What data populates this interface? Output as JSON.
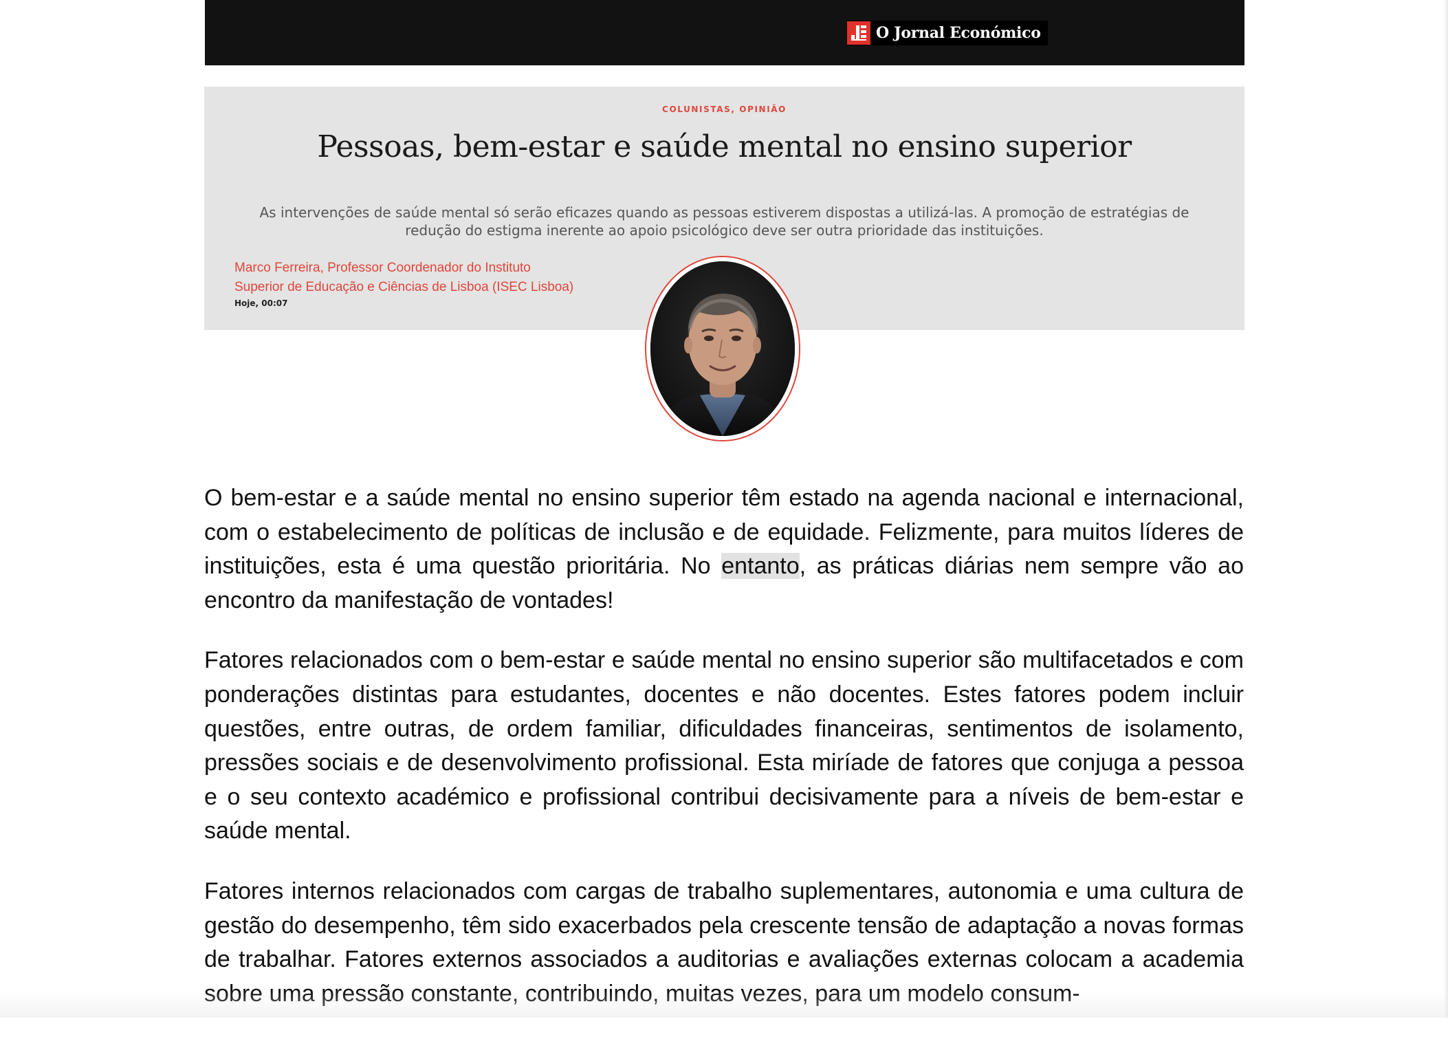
{
  "masthead": {
    "brand_name": "O Jornal Económico",
    "logo_icon": "je-logo-icon"
  },
  "hero": {
    "category": "COLUNISTAS, OPINIÃO",
    "title": "Pessoas, bem-estar e saúde mental no ensino superior",
    "lead_line1": "As intervenções de saúde mental só serão eficazes quando as pessoas estiverem dispostas a utilizá-las. A promoção de estratégias de",
    "lead_line2": "redução do estigma inerente ao apoio psicológico deve ser outra prioridade das instituições.",
    "author_line1": "Marco Ferreira, Professor Coordenador do Instituto",
    "author_line2": "Superior de Educação e Ciências de Lisboa (ISEC Lisboa)",
    "date": "Hoje, 00:07",
    "accent_color": "#e0463b"
  },
  "article": {
    "p1_before": "O bem-estar e a saúde mental no ensino superior têm estado na agenda nacional e internacional, com o estabelecimento de políticas de inclusão e de equidade. Felizmente, para muitos líderes de instituições, esta é uma questão prioritária. No ",
    "p1_highlight": "entanto",
    "p1_after": ", as práticas diárias nem sempre vão ao encontro da manifestação de vontades!",
    "p2": "Fatores relacionados com o bem-estar e saúde mental no ensino superior são multifacetados e com ponderações distintas para estudantes, docentes e não docentes. Estes fatores podem incluir questões, entre outras, de ordem familiar, dificuldades financeiras, sentimentos de isola­mento, pressões sociais e de desenvolvimento profissional. Esta miríade de fatores que conjuga a pessoa e o seu contexto académico e profissional contribui decisivamente para a níveis de bem-estar e saúde mental.",
    "p3": "Fatores internos relacionados com cargas de trabalho suplementares, autonomia e uma cultura de gestão do desempenho, têm sido exacerbados pela crescente tensão de adaptação a novas formas de trabalhar. Fatores externos associados a auditorias e avaliações externas colocam a academia sobre uma pressão constante, contribuindo, muitas vezes, para um modelo consum-"
  }
}
